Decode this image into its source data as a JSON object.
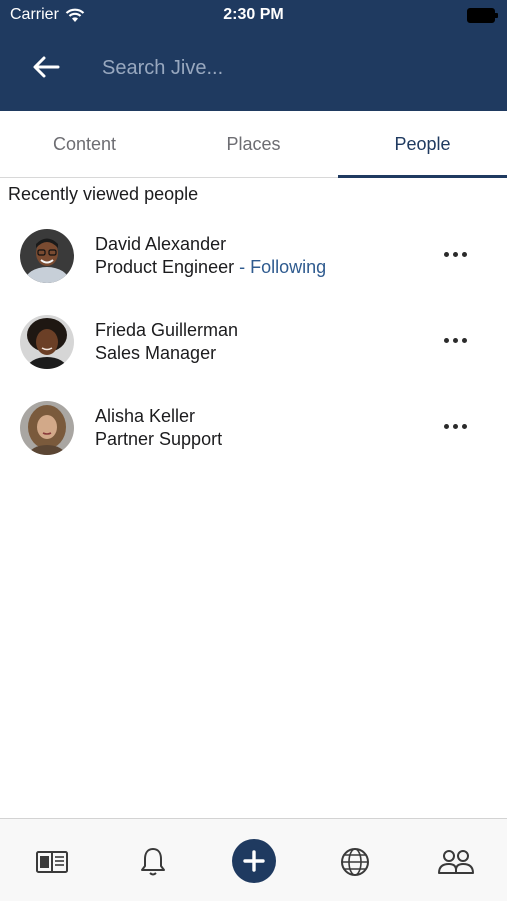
{
  "status_bar": {
    "carrier": "Carrier",
    "time": "2:30 PM"
  },
  "header": {
    "search_placeholder": "Search Jive..."
  },
  "tabs": [
    {
      "label": "Content",
      "active": false
    },
    {
      "label": "Places",
      "active": false
    },
    {
      "label": "People",
      "active": true
    }
  ],
  "section_title": "Recently viewed people",
  "people": [
    {
      "name": "David Alexander",
      "title": "Product Engineer",
      "following": " - Following"
    },
    {
      "name": "Frieda Guillerman",
      "title": "Sales Manager",
      "following": ""
    },
    {
      "name": "Alisha Keller",
      "title": "Partner Support",
      "following": ""
    }
  ],
  "bottom_nav": [
    "news-icon",
    "bell-icon",
    "plus-icon",
    "globe-icon",
    "people-icon"
  ],
  "colors": {
    "brand": "#1f3a60",
    "link": "#2f5b8f"
  }
}
